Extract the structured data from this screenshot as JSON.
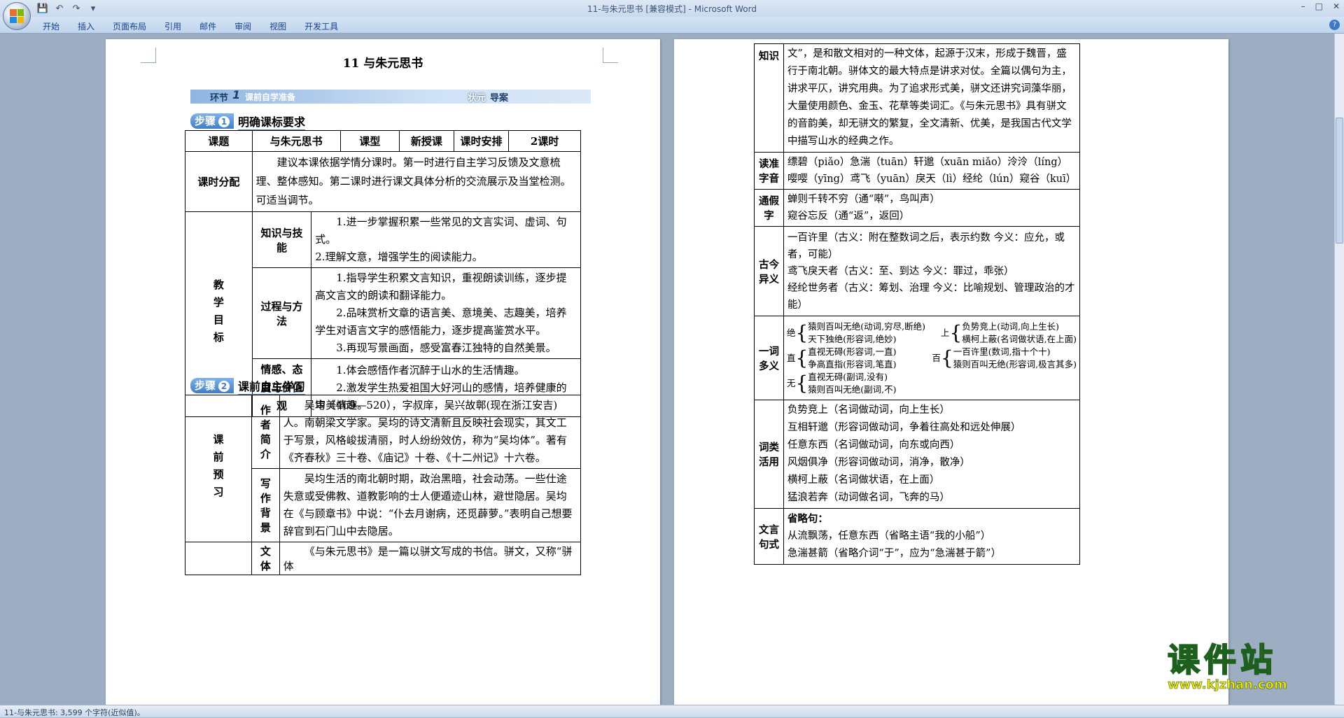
{
  "titlebar": {
    "title": "11-与朱元思书 [兼容模式] - Microsoft Word"
  },
  "qat": {
    "save_icon": "save-icon",
    "undo_icon": "undo-icon",
    "redo_icon": "redo-icon",
    "customize_icon": "customize-icon"
  },
  "window": {
    "minimize": "–",
    "maximize": "□",
    "close": "✕"
  },
  "ribbon": {
    "tabs": [
      "开始",
      "插入",
      "页面布局",
      "引用",
      "邮件",
      "审阅",
      "视图",
      "开发工具"
    ],
    "help": "?"
  },
  "status": {
    "text": "11-与朱元思书: 3,599 个字符(近似值)。"
  },
  "page1": {
    "title": "11  与朱元思书",
    "banner": {
      "label": "环节",
      "num": "1",
      "text": "课前自学准备",
      "right1": "状元",
      "right2": "导案"
    },
    "step1": {
      "label": "步骤",
      "num": "1",
      "title": "明确课标要求"
    },
    "table1": {
      "h_subject": "课题",
      "v_subject": "与朱元思书",
      "h_type": "课型",
      "v_type": "新授课",
      "h_plan": "课时安排",
      "v_plan": "2课时",
      "h_alloc": "课时分配",
      "v_alloc": "建议本课依据学情分课时。第一时进行自主学习反馈及文意梳理、整体感知。第二课时进行课文具体分析的交流展示及当堂检测。可适当调节。",
      "h_goal": "教学目标",
      "g1_label": "知识与技能",
      "g1_a": "1.进一步掌握积累一些常见的文言实词、虚词、句式。",
      "g1_b": "2.理解文意，增强学生的阅读能力。",
      "g2_label": "过程与方法",
      "g2_a": "1.指导学生积累文言知识，重视朗读训练，逐步提高文言文的朗读和翻译能力。",
      "g2_b": "2.品味赏析文章的语言美、意境美、志趣美，培养学生对语言文字的感悟能力，逐步提高鉴赏水平。",
      "g2_c": "3.再现写景画面，感受富春江独特的自然美景。",
      "g3_label": "情感、态度与价值观",
      "g3_a": "1.体会感悟作者沉醉于山水的生活情趣。",
      "g3_b": "2.激发学生热爱祖国大好河山的感情，培养健康的审美情趣。"
    },
    "step2": {
      "label": "步骤",
      "num": "2",
      "title": "课前自主学习"
    },
    "table2": {
      "h_pre": "课前预习",
      "author_label": "作者简介",
      "author_text": "吴均（469—520），字叔庠，吴兴故鄣(现在浙江安吉)人。南朝梁文学家。吴均的诗文清新且反映社会现实，其文工于写景，风格峻拔清丽，时人纷纷效仿，称为“吴均体”。著有《齐春秋》三十卷、《庙记》十卷、《十二州记》十六卷。",
      "bg_label": "写作背景",
      "bg_text": "吴均生活的南北朝时期，政治黑暗，社会动荡。一些仕途失意或受佛教、道教影响的士人便遁迹山林，避世隐居。吴均在《与顾章书》中说：“仆去月谢病，还觅薜萝。”表明自己想要辞官到石门山中去隐居。",
      "style_label": "文体",
      "style_text": "《与朱元思书》是一篇以骈文写成的书信。骈文，又称“骈体"
    }
  },
  "page2": {
    "table": {
      "h_know": "知识",
      "v_know": "文”，是和散文相对的一种文体，起源于汉末，形成于魏晋，盛行于南北朝。骈体文的最大特点是讲求对仗。全篇以偶句为主，讲求平仄，讲究用典。为了追求形式美，骈文还讲究词藻华丽，大量使用颜色、金玉、花草等类词汇。《与朱元思书》具有骈文的音韵美，却无骈文的繁复，全文清新、优美，是我国古代文学中描写山水的经典之作。",
      "h_read": "读准字音",
      "v_read1": "缥碧（piǎo）急湍（tuān）轩邈（xuān miǎo）泠泠（líng）",
      "v_read2": "嘤嘤（yīng）鸢飞（yuān）戾天（lì）经纶（lún）窥谷（kuī）",
      "h_tongjia": "通假字",
      "v_tj1": "蝉则千转不穷（通“啭”，鸟叫声）",
      "v_tj2": "窥谷忘反（通“返”，返回）",
      "h_gujin": "古今异义",
      "v_gj1": "一百许里（古义：附在整数词之后，表示约数   今义：应允，或者，可能）",
      "v_gj2": "鸢飞戾天者（古义：至、到达   今义：罪过，乖张）",
      "v_gj3": "经纶世务者（古义：筹划、治理   今义：比喻规划、管理政治的才能）",
      "h_yici": "一词多义",
      "yc_jue": "绝",
      "yc_jue1": "猿则百叫无绝(动词,穷尽,断绝)",
      "yc_jue2": "天下独绝(形容词,绝妙)",
      "yc_shang": "上",
      "yc_shang1": "负势竞上(动词,向上生长)",
      "yc_shang2": "横柯上蔽(名词做状语,在上面)",
      "yc_zhi": "直",
      "yc_zhi1": "直视无碍(形容词,一直)",
      "yc_zhi2": "争高直指(形容词,笔直)",
      "yc_bai": "百",
      "yc_bai1": "一百许里(数词,指十个十)",
      "yc_bai2": "猿则百叫无绝(形容词,极言其多)",
      "yc_wu": "无",
      "yc_wu1": "直视无碍(副词,没有)",
      "yc_wu2": "猿则百叫无绝(副词,不)",
      "h_cilei": "词类活用",
      "v_cl1": "负势竞上（名词做动词，向上生长）",
      "v_cl2": "互相轩邈（形容词做动词，争着往高处和远处伸展）",
      "v_cl3": "任意东西（名词做动词，向东或向西）",
      "v_cl4": "风烟俱净（形容词做动词，消净，散净）",
      "v_cl5": "横柯上蔽（名词做状语，在上面）",
      "v_cl6": "猛浪若奔（动词做名词，飞奔的马）",
      "h_jushi": "文言句式",
      "v_js0": "省略句：",
      "v_js1": "从流飘荡，任意东西（省略主语“我的小船”）",
      "v_js2": "急湍甚箭（省略介词“于”，应为“急湍甚于箭”）"
    }
  },
  "watermark": {
    "main": "课件站",
    "url": "www.kjzhan.com"
  },
  "colors": {
    "accent": "#3f7fc6",
    "wm_yellow": "#ffe600",
    "wm_green": "#0a7d2a"
  }
}
